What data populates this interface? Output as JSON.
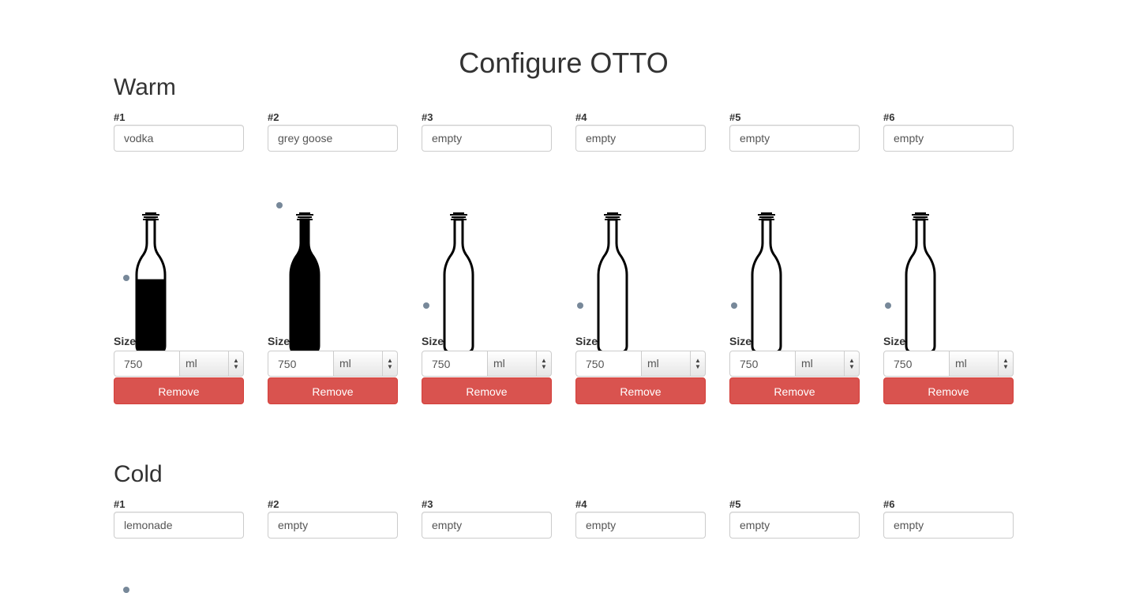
{
  "page_title": "Configure OTTO",
  "sections": [
    {
      "title": "Warm",
      "slots": [
        {
          "label": "#1",
          "name": "vodka",
          "fill": 0.55,
          "size_label": "Size",
          "size": "750",
          "unit": "ml",
          "remove_label": "Remove"
        },
        {
          "label": "#2",
          "name": "grey goose",
          "fill": 1.0,
          "size_label": "Size",
          "size": "750",
          "unit": "ml",
          "remove_label": "Remove"
        },
        {
          "label": "#3",
          "name": "empty",
          "fill": 0.0,
          "size_label": "Size",
          "size": "750",
          "unit": "ml",
          "remove_label": "Remove"
        },
        {
          "label": "#4",
          "name": "empty",
          "fill": 0.0,
          "size_label": "Size",
          "size": "750",
          "unit": "ml",
          "remove_label": "Remove"
        },
        {
          "label": "#5",
          "name": "empty",
          "fill": 0.0,
          "size_label": "Size",
          "size": "750",
          "unit": "ml",
          "remove_label": "Remove"
        },
        {
          "label": "#6",
          "name": "empty",
          "fill": 0.0,
          "size_label": "Size",
          "size": "750",
          "unit": "ml",
          "remove_label": "Remove"
        }
      ]
    },
    {
      "title": "Cold",
      "slots": [
        {
          "label": "#1",
          "name": "lemonade"
        },
        {
          "label": "#2",
          "name": "empty"
        },
        {
          "label": "#3",
          "name": "empty"
        },
        {
          "label": "#4",
          "name": "empty"
        },
        {
          "label": "#5",
          "name": "empty"
        },
        {
          "label": "#6",
          "name": "empty"
        }
      ]
    }
  ],
  "colors": {
    "danger": "#d9534f",
    "level_dot": "#778899",
    "bottle_stroke": "#000000"
  }
}
